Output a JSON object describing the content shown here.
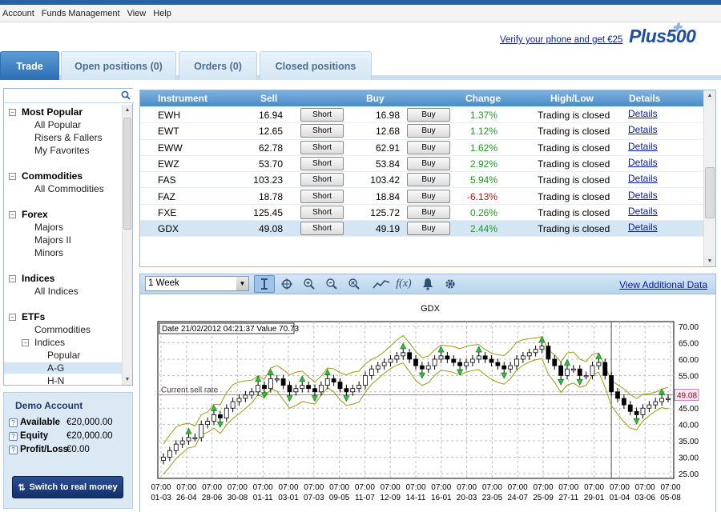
{
  "menu": [
    "Account",
    "Funds Management",
    "View",
    "Help"
  ],
  "header": {
    "verify_link": "Verify your phone and get €25",
    "logo": "Plus500"
  },
  "tabs": [
    "Trade",
    "Open positions (0)",
    "Orders (0)",
    "Closed positions"
  ],
  "tree": [
    {
      "label": "Most Popular",
      "type": "cat",
      "expander": "⊟"
    },
    {
      "label": "All Popular",
      "type": "sub"
    },
    {
      "label": "Risers & Fallers",
      "type": "sub"
    },
    {
      "label": "My Favorites",
      "type": "sub"
    },
    {
      "label": "Commodities",
      "type": "cat",
      "expander": "⊟"
    },
    {
      "label": "All Commodities",
      "type": "sub"
    },
    {
      "label": "Forex",
      "type": "cat",
      "expander": "⊟"
    },
    {
      "label": "Majors",
      "type": "sub"
    },
    {
      "label": "Majors II",
      "type": "sub"
    },
    {
      "label": "Minors",
      "type": "sub"
    },
    {
      "label": "Indices",
      "type": "cat",
      "expander": "⊟"
    },
    {
      "label": "All Indices",
      "type": "sub"
    },
    {
      "label": "ETFs",
      "type": "cat",
      "expander": "⊟"
    },
    {
      "label": "Commodities",
      "type": "sub"
    },
    {
      "label": "Indices",
      "type": "sub2",
      "expander": "⊟"
    },
    {
      "label": "Popular",
      "type": "sub3"
    },
    {
      "label": "A-G",
      "type": "sub3",
      "selected": true
    },
    {
      "label": "H-N",
      "type": "sub3"
    }
  ],
  "account": {
    "title": "Demo Account",
    "rows": [
      {
        "label": "Available",
        "value": "€20,000.00"
      },
      {
        "label": "Equity",
        "value": "€20,000.00"
      },
      {
        "label": "Profit/Loss",
        "value": "€0.00"
      }
    ],
    "switch_button": "Switch to real money"
  },
  "table": {
    "headers": [
      "Instrument",
      "Sell",
      "Buy",
      "Change",
      "High/Low",
      "Details"
    ],
    "short_label": "Short",
    "buy_label": "Buy",
    "rows": [
      {
        "instrument": "EWH",
        "sell": "16.94",
        "buy": "16.98",
        "change": "1.37%",
        "negative": false,
        "highlow": "Trading is closed",
        "details": "Details"
      },
      {
        "instrument": "EWT",
        "sell": "12.65",
        "buy": "12.68",
        "change": "1.12%",
        "negative": false,
        "highlow": "Trading is closed",
        "details": "Details"
      },
      {
        "instrument": "EWW",
        "sell": "62.78",
        "buy": "62.91",
        "change": "1.62%",
        "negative": false,
        "highlow": "Trading is closed",
        "details": "Details"
      },
      {
        "instrument": "EWZ",
        "sell": "53.70",
        "buy": "53.84",
        "change": "2.92%",
        "negative": false,
        "highlow": "Trading is closed",
        "details": "Details"
      },
      {
        "instrument": "FAS",
        "sell": "103.23",
        "buy": "103.42",
        "change": "5.94%",
        "negative": false,
        "highlow": "Trading is closed",
        "details": "Details"
      },
      {
        "instrument": "FAZ",
        "sell": "18.78",
        "buy": "18.84",
        "change": "-6.13%",
        "negative": true,
        "highlow": "Trading is closed",
        "details": "Details"
      },
      {
        "instrument": "FXE",
        "sell": "125.45",
        "buy": "125.72",
        "change": "0.26%",
        "negative": false,
        "highlow": "Trading is closed",
        "details": "Details"
      },
      {
        "instrument": "GDX",
        "sell": "49.08",
        "buy": "49.19",
        "change": "2.44%",
        "negative": false,
        "highlow": "Trading is closed",
        "details": "Details",
        "selected": true
      }
    ]
  },
  "chart_toolbar": {
    "period": "1 Week",
    "tools": [
      "cursor-icon",
      "crosshair-icon",
      "zoom-in-icon",
      "zoom-out-icon",
      "zoom-reset-icon",
      "line-icon",
      "function-icon",
      "alert-bell-icon",
      "settings-icon"
    ],
    "function_label": "f(x)",
    "view_additional": "View Additional Data"
  },
  "chart_data": {
    "type": "candlestick",
    "title": "GDX",
    "tooltip": "Date 21/02/2012 04:21:37 Value 70.73",
    "current_rate_label": "Current sell rate",
    "current_rate": 49.08,
    "current_rate_text": "49.08",
    "ylim": [
      23.5,
      71.5
    ],
    "y_ticks": [
      "70.00",
      "65.00",
      "60.00",
      "55.00",
      "50.00",
      "45.00",
      "40.00",
      "35.00",
      "30.00",
      "25.00"
    ],
    "x_times": [
      "07:00",
      "07:00",
      "07:00",
      "07:00",
      "07:00",
      "07:00",
      "07:00",
      "07:00",
      "07:00",
      "07:00",
      "07:00",
      "07:00",
      "07:00",
      "07:00",
      "07:00",
      "07:00",
      "07:00",
      "07:00",
      "07:00",
      "07:00",
      "07:00"
    ],
    "x_dates": [
      "01-03",
      "26-04",
      "28-06",
      "30-08",
      "01-11",
      "03-01",
      "07-03",
      "09-05",
      "11-07",
      "12-09",
      "14-11",
      "16-01",
      "20-03",
      "23-05",
      "24-07",
      "25-09",
      "27-11",
      "29-01",
      "01-04",
      "03-06",
      "05-08"
    ],
    "close_series": [
      30,
      32,
      34,
      35,
      36,
      36,
      40,
      41,
      43,
      42,
      45,
      47,
      48,
      49,
      50,
      52,
      51,
      54,
      54,
      52,
      50,
      51,
      52,
      51,
      50,
      52,
      54,
      53,
      51,
      50,
      51,
      52,
      55,
      57,
      58,
      59,
      60,
      61,
      62,
      60,
      58,
      57,
      58,
      60,
      61,
      60,
      59,
      58,
      59,
      60,
      61,
      60,
      59,
      58,
      57,
      58,
      60,
      61,
      62,
      63,
      64,
      60,
      58,
      55,
      57,
      57,
      55,
      55,
      58,
      59,
      55,
      50,
      48,
      46,
      44,
      43,
      45,
      46,
      47,
      48,
      48
    ]
  }
}
